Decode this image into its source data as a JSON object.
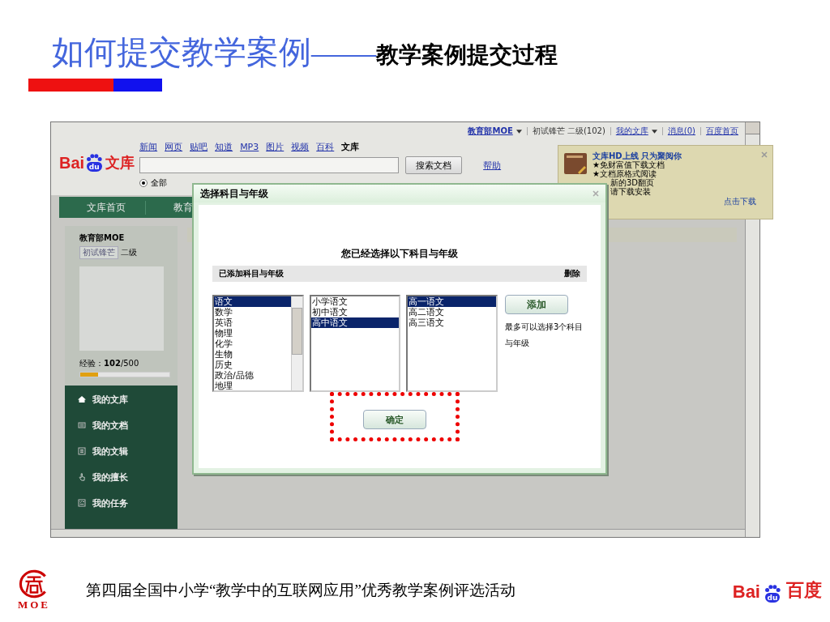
{
  "slide": {
    "title": "如何提交教学案例——",
    "subtitle": "教学案例提交过程"
  },
  "browser": {
    "user_bar": [
      {
        "kind": "menu",
        "text": "教育部MOE"
      },
      {
        "kind": "plain",
        "text": "初试锋芒 二级(102)"
      },
      {
        "kind": "menu",
        "text": "我的文库"
      },
      {
        "kind": "link",
        "text": "消息(0)"
      },
      {
        "kind": "link",
        "text": "百度首页"
      }
    ],
    "logo": {
      "brand": "Bai",
      "badge": "du",
      "product": "文库"
    },
    "nav_links": [
      {
        "label": "新闻",
        "selected": false
      },
      {
        "label": "网页",
        "selected": false
      },
      {
        "label": "贴吧",
        "selected": false
      },
      {
        "label": "知道",
        "selected": false
      },
      {
        "label": "MP3",
        "selected": false
      },
      {
        "label": "图片",
        "selected": false
      },
      {
        "label": "视频",
        "selected": false
      },
      {
        "label": "百科",
        "selected": false
      },
      {
        "label": "文库",
        "selected": true
      }
    ],
    "search": {
      "button": "搜索文档",
      "help": "帮助"
    },
    "filters": [
      {
        "label": "全部",
        "selected": true
      }
    ],
    "nav_tabs": [
      "文库首页",
      "教育"
    ],
    "profile": {
      "name": "教育部MOE",
      "badge": "初试锋芒",
      "rank": "二级",
      "exp": "经验：**102**/500",
      "progress": {
        "level": 0.2
      }
    },
    "menu": [
      {
        "kind": "home",
        "label": "我的文库"
      },
      {
        "kind": "document",
        "label": "我的文档"
      },
      {
        "kind": "collection",
        "label": "我的文辑"
      },
      {
        "kind": "hand",
        "label": "我的擅长"
      },
      {
        "kind": "task",
        "label": "我的任务"
      }
    ],
    "promo": {
      "title": "文库HD上线  只为聚阅你",
      "lines": [
        "★免财富值下载文档",
        "★文档原格式阅读"
      ],
      "cut_lines": [
        "新的3D翻页",
        "请下载安装"
      ],
      "link": "点击下载"
    },
    "dialog": {
      "title": "选择科目与年级",
      "heading": "您已经选择以下科目与年级",
      "added_label": "已添加科目与年级",
      "delete": "删除",
      "lists": [
        {
          "scroll": true,
          "items": [
            {
              "label": "语文",
              "selected": true
            },
            {
              "label": "数学",
              "selected": false
            },
            {
              "label": "英语",
              "selected": false
            },
            {
              "label": "物理",
              "selected": false
            },
            {
              "label": "化学",
              "selected": false
            },
            {
              "label": "生物",
              "selected": false
            },
            {
              "label": "历史",
              "selected": false
            },
            {
              "label": "政治/品德",
              "selected": false
            },
            {
              "label": "地理",
              "selected": false
            }
          ]
        },
        {
          "scroll": false,
          "items": [
            {
              "label": "小学语文",
              "selected": false
            },
            {
              "label": "初中语文",
              "selected": false
            },
            {
              "label": "高中语文",
              "selected": true
            }
          ]
        },
        {
          "scroll": false,
          "items": [
            {
              "label": "高一语文",
              "selected": true
            },
            {
              "label": "高二语文",
              "selected": false
            },
            {
              "label": "高三语文",
              "selected": false
            }
          ]
        }
      ],
      "add_button": "添加",
      "note": "最多可以选择3个科目与年级",
      "confirm": "确定"
    }
  },
  "footer": {
    "moe_logo": "MOE",
    "text": "第四届全国中小学“教学中的互联网应用”优秀教学案例评选活动",
    "baidu_logo": {
      "brand": "Bai",
      "badge": "du",
      "product": "百度"
    }
  }
}
